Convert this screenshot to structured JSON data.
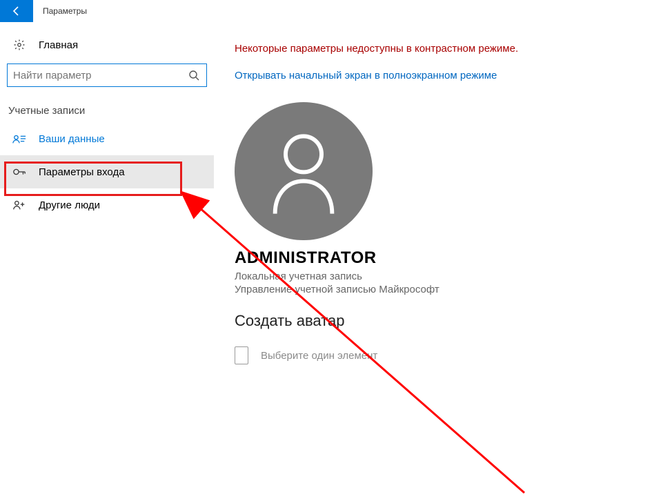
{
  "titlebar": {
    "title": "Параметры"
  },
  "sidebar": {
    "home_label": "Главная",
    "search_placeholder": "Найти параметр",
    "section_title": "Учетные записи",
    "items": [
      {
        "label": "Ваши данные"
      },
      {
        "label": "Параметры входа"
      },
      {
        "label": "Другие люди"
      }
    ]
  },
  "main": {
    "warning": "Некоторые параметры недоступны в контрастном режиме.",
    "link": "Открывать начальный экран в полноэкранном режиме",
    "username": "ADMINISTRATOR",
    "account_type": "Локальная учетная запись",
    "manage_link": "Управление учетной записью Майкрософт",
    "create_avatar": "Создать аватар",
    "picker_text": "Выберите один элемент"
  }
}
